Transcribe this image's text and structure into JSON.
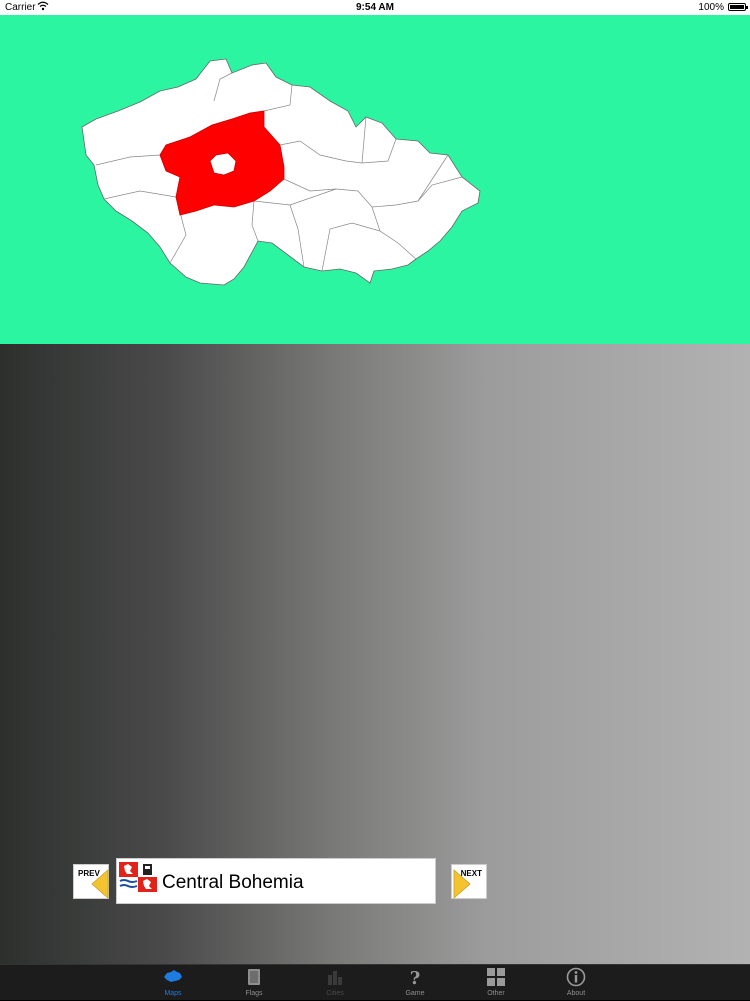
{
  "status_bar": {
    "carrier": "Carrier",
    "time": "9:54 AM",
    "battery": "100%"
  },
  "map": {
    "background_color": "#2cf5a2",
    "highlight_color": "#ff0000",
    "region_fill": "#ffffff"
  },
  "navigation": {
    "prev_label": "PREV",
    "next_label": "NEXT"
  },
  "region": {
    "name": "Central Bohemia"
  },
  "tabs": [
    {
      "label": "Maps",
      "icon": "map-icon",
      "active": true
    },
    {
      "label": "Flags",
      "icon": "flag-book-icon",
      "active": false
    },
    {
      "label": "Cities",
      "icon": "cities-icon",
      "active": false
    },
    {
      "label": "Game",
      "icon": "question-icon",
      "active": false
    },
    {
      "label": "Other",
      "icon": "grid-icon",
      "active": false
    },
    {
      "label": "About",
      "icon": "info-icon",
      "active": false
    }
  ],
  "colors": {
    "tab_active": "#1e7be0",
    "tab_bar": "#1c1c1c",
    "arrow_yellow": "#f4c430"
  }
}
